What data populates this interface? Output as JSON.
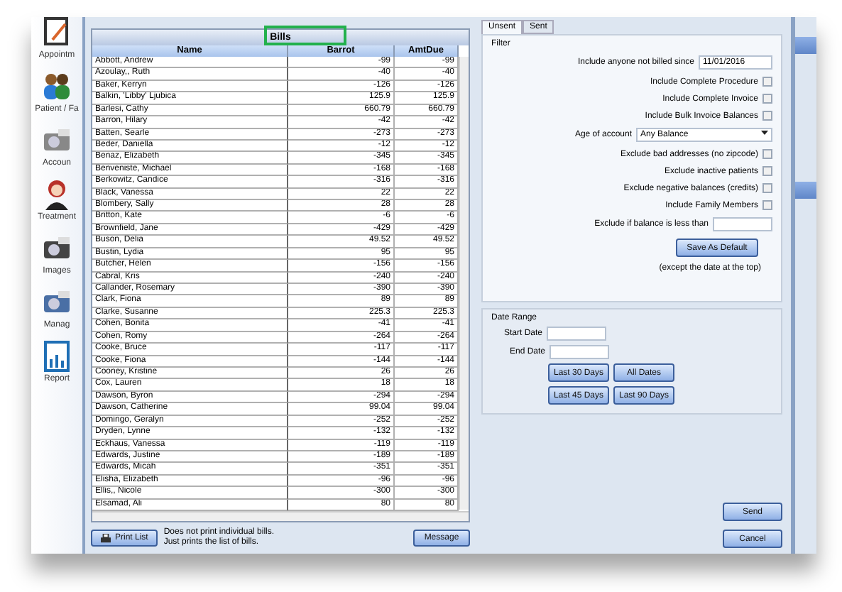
{
  "sidebar": {
    "items": [
      {
        "label": "Appointm"
      },
      {
        "label": "Patient / Fa"
      },
      {
        "label": "Accoun"
      },
      {
        "label": "Treatment"
      },
      {
        "label": "Images"
      },
      {
        "label": "Manag"
      },
      {
        "label": "Report"
      }
    ]
  },
  "table": {
    "title": "Bills",
    "columns": [
      "Name",
      "Barrot",
      "AmtDue"
    ],
    "rows": [
      [
        "Abbott, Andrew",
        "-99",
        "-99"
      ],
      [
        "Azoulay,, Ruth",
        "-40",
        "-40"
      ],
      [
        "Baker, Kerryn",
        "-126",
        "-126"
      ],
      [
        "Balkin, 'Libby' Ljubica",
        "125.9",
        "125.9"
      ],
      [
        "Barlesi, Cathy",
        "660.79",
        "660.79"
      ],
      [
        "Barron, Hilary",
        "-42",
        "-42"
      ],
      [
        "Batten, Searle",
        "-273",
        "-273"
      ],
      [
        "Beder, Daniella",
        "-12",
        "-12"
      ],
      [
        "Benaz, Elizabeth",
        "-345",
        "-345"
      ],
      [
        "Benveniste, Michael",
        "-168",
        "-168"
      ],
      [
        "Berkowitz, Candice",
        "-316",
        "-316"
      ],
      [
        "Black, Vanessa",
        "22",
        "22"
      ],
      [
        "Blombery, Sally",
        "28",
        "28"
      ],
      [
        "Britton, Kate",
        "-6",
        "-6"
      ],
      [
        "Brownfield, Jane",
        "-429",
        "-429"
      ],
      [
        "Buson, Delia",
        "49.52",
        "49.52"
      ],
      [
        "Bustin, Lydia",
        "95",
        "95"
      ],
      [
        "Butcher, Helen",
        "-156",
        "-156"
      ],
      [
        "Cabral, Kris",
        "-240",
        "-240"
      ],
      [
        "Callander, Rosemary",
        "-390",
        "-390"
      ],
      [
        "Clark, Fiona",
        "89",
        "89"
      ],
      [
        "Clarke, Susanne",
        "225.3",
        "225.3"
      ],
      [
        "Cohen, Bonita",
        "-41",
        "-41"
      ],
      [
        "Cohen, Romy",
        "-264",
        "-264"
      ],
      [
        "Cooke, Bruce",
        "-117",
        "-117"
      ],
      [
        "Cooke, Fiona",
        "-144",
        "-144"
      ],
      [
        "Cooney, Kristine",
        "26",
        "26"
      ],
      [
        "Cox, Lauren",
        "18",
        "18"
      ],
      [
        "Dawson, Byron",
        "-294",
        "-294"
      ],
      [
        "Dawson, Catherine",
        "99.04",
        "99.04"
      ],
      [
        "Domingo, Geralyn",
        "-252",
        "-252"
      ],
      [
        "Dryden, Lynne",
        "-132",
        "-132"
      ],
      [
        "Eckhaus, Vanessa",
        "-119",
        "-119"
      ],
      [
        "Edwards, Justine",
        "-189",
        "-189"
      ],
      [
        "Edwards, Micah",
        "-351",
        "-351"
      ],
      [
        "Elisha, Elizabeth",
        "-96",
        "-96"
      ],
      [
        "Ellis,, Nicole",
        "-300",
        "-300"
      ],
      [
        "Elsamad, Ali",
        "80",
        "80"
      ]
    ]
  },
  "footer": {
    "print_button": "Print List",
    "note": "Does not print individual bills.\nJust prints the list of bills.",
    "message_button": "Message"
  },
  "tabs": [
    {
      "label": "Unsent",
      "selected": true
    },
    {
      "label": "Sent",
      "selected": false
    }
  ],
  "filter": {
    "title": "Filter",
    "since": {
      "label": "Include anyone not billed since",
      "value": "11/01/2016"
    },
    "options": [
      {
        "kind": "check",
        "label": "Include Complete Procedure",
        "checked": false
      },
      {
        "kind": "check",
        "label": "Include Complete Invoice",
        "checked": false
      },
      {
        "kind": "check",
        "label": "Include Bulk Invoice Balances",
        "checked": false
      },
      {
        "kind": "select",
        "label": "Age of account",
        "value": "Any Balance"
      },
      {
        "kind": "check",
        "label": "Exclude bad addresses (no zipcode)",
        "checked": false
      },
      {
        "kind": "check",
        "label": "Exclude inactive patients",
        "checked": false
      },
      {
        "kind": "check",
        "label": "Exclude negative balances (credits)",
        "checked": false
      },
      {
        "kind": "check",
        "label": "Include Family Members",
        "checked": false
      },
      {
        "kind": "text",
        "label": "Exclude if balance is less than"
      }
    ],
    "save_button": "Save As Default",
    "save_note": "(except the date at the top)"
  },
  "date_range": {
    "title": "Date Range",
    "fields": [
      "Start Date",
      "End Date"
    ],
    "buttons": [
      "Last 30 Days",
      "All Dates",
      "Last 45 Days",
      "Last 90 Days"
    ]
  },
  "actions": [
    "Send",
    "Cancel"
  ]
}
